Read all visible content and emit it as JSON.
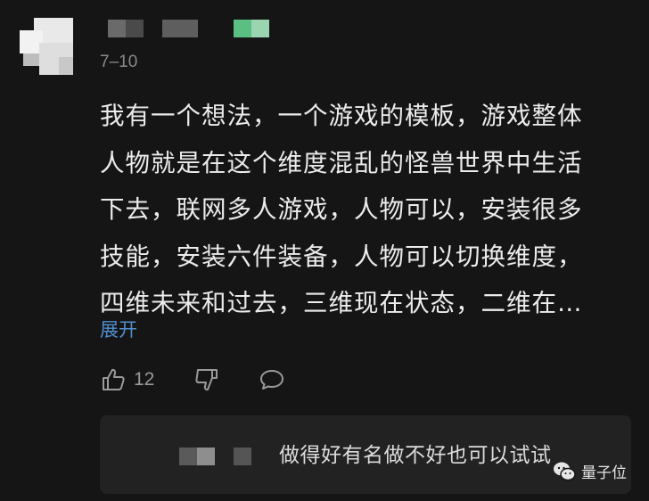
{
  "comment": {
    "date": "7–10",
    "lines": [
      "我有一个想法，一个游戏的模板，游戏整体",
      "人物就是在这个维度混乱的怪兽世界中生活",
      "下去，联网多人游戏，人物可以，安装很多",
      "技能，安装六件装备，人物可以切换维度，",
      "四维未来和过去，三维现在状态，二维在…"
    ],
    "expand_label": "展开",
    "like_count": "12"
  },
  "reply": {
    "text": "做得好有名做不好也可以试试"
  },
  "watermark": {
    "label": "量子位"
  },
  "colors": {
    "background": "#151515",
    "link": "#4f8fcf",
    "reply_bg": "#222222",
    "icon": "#9a9a9a"
  },
  "icons": [
    "like-icon",
    "dislike-icon",
    "comment-icon",
    "wechat-logo-icon"
  ]
}
